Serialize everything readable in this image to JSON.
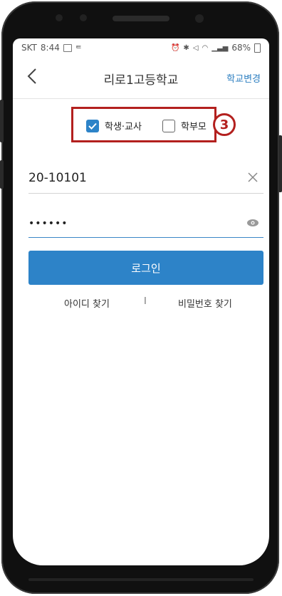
{
  "status_bar": {
    "carrier": "SKT",
    "time": "8:44",
    "battery": "68%"
  },
  "header": {
    "title": "리로1고등학교",
    "change_school": "학교변경"
  },
  "roles": {
    "student_teacher": {
      "label": "학생·교사",
      "checked": true
    },
    "parent": {
      "label": "학부모",
      "checked": false
    }
  },
  "annotation": {
    "step": "3"
  },
  "form": {
    "id_value": "20-10101",
    "password_value": "••••••",
    "login_label": "로그인"
  },
  "links": {
    "find_id": "아이디 찾기",
    "separator": "I",
    "find_password": "비밀번호 찾기"
  },
  "colors": {
    "accent": "#2d83c8",
    "annotation": "#b3201e"
  }
}
